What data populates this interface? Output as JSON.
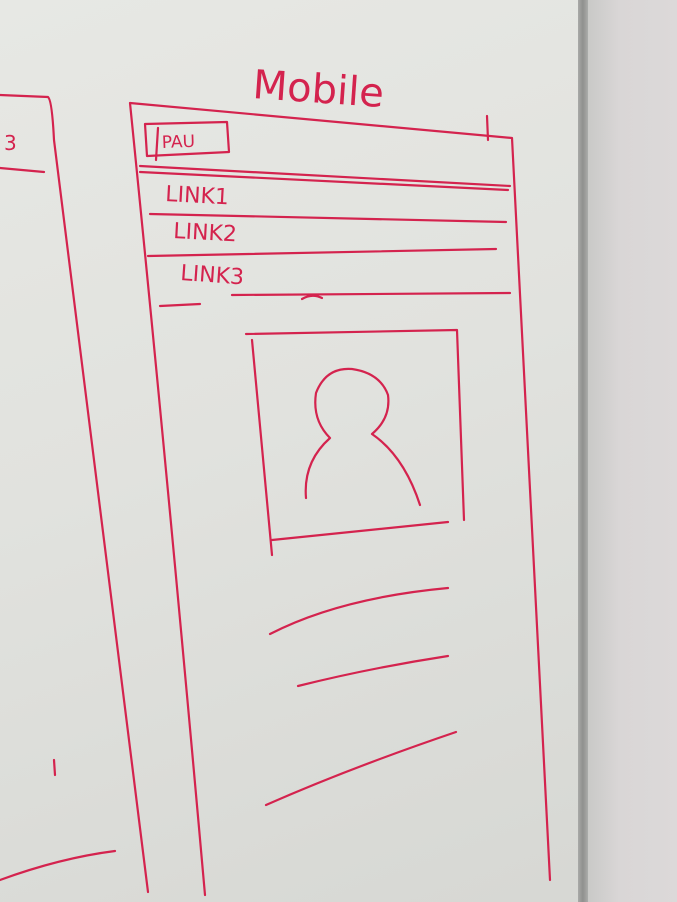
{
  "whiteboard": {
    "title": "Mobile",
    "logo_label": "PAU",
    "nav_links": [
      "LINK1",
      "LINK2",
      "LINK3"
    ],
    "left_sketch_fragment": "3",
    "marker_color": "#d4234e"
  }
}
